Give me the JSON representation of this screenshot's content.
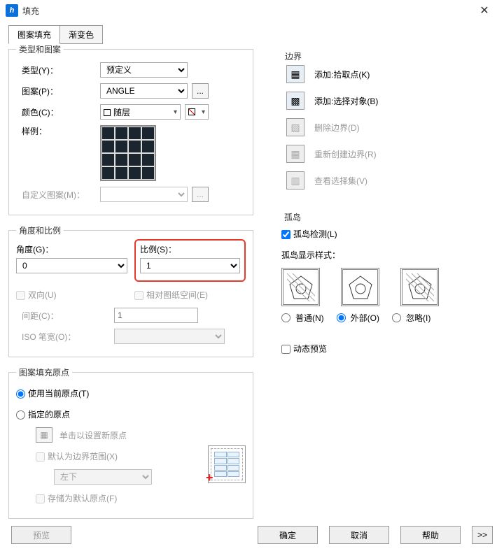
{
  "window": {
    "title": "填充"
  },
  "tabs": {
    "pattern_fill": "图案填充",
    "gradient": "渐变色"
  },
  "type_pattern_group": {
    "legend": "类型和图案",
    "type_label": "类型(Y)：",
    "type_value": "预定义",
    "pattern_label": "图案(P)：",
    "pattern_value": "ANGLE",
    "pattern_more": "...",
    "color_label": "颜色(C)：",
    "color_value": "随层",
    "sample_label": "样例：",
    "custom_label": "自定义图案(M)：",
    "custom_more": "..."
  },
  "angle_scale_group": {
    "legend": "角度和比例",
    "angle_label": "角度(G)：",
    "angle_value": "0",
    "scale_label": "比例(S)：",
    "scale_value": "1",
    "double_dir": "双向(U)",
    "relative_paper": "相对图纸空间(E)",
    "spacing_label": "间距(C)：",
    "spacing_value": "1",
    "iso_pen_label": "ISO 笔宽(O)："
  },
  "origin_group": {
    "legend": "图案填充原点",
    "use_current": "使用当前原点(T)",
    "specified": "指定的原点",
    "click_set_new": "单击以设置新原点",
    "default_bounds": "默认为边界范围(X)",
    "corner_value": "左下",
    "store_default": "存储为默认原点(F)"
  },
  "boundary_group": {
    "legend": "边界",
    "add_pick": "添加:拾取点(K)",
    "add_select": "添加:选择对象(B)",
    "remove": "删除边界(D)",
    "recreate": "重新创建边界(R)",
    "view_sel": "查看选择集(V)"
  },
  "island_group": {
    "legend": "孤岛",
    "detect": "孤岛检测(L)",
    "style_label": "孤岛显示样式：",
    "styles": {
      "normal": "普通(N)",
      "outer": "外部(O)",
      "ignore": "忽略(I)"
    }
  },
  "dynamic_preview": "动态预览",
  "buttons": {
    "preview": "预览",
    "ok": "确定",
    "cancel": "取消",
    "help": "帮助",
    "expand": ">>"
  }
}
